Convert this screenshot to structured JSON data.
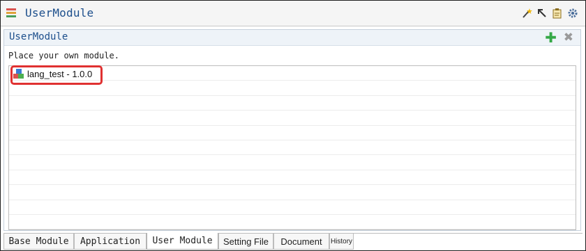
{
  "window": {
    "title": "UserModule",
    "toolbar_icons": [
      "magic-wand-icon",
      "arrow-up-left-icon",
      "clipboard-icon",
      "gear-icon"
    ]
  },
  "panel": {
    "title": "UserModule",
    "add_icon": "plus-icon",
    "close_icon": "close-icon",
    "hint": "Place your own module."
  },
  "modules": [
    {
      "name": "lang_test - 1.0.0",
      "icon": "module-blocks-icon"
    }
  ],
  "highlight_color": "#e03131",
  "tabs": [
    {
      "label": "Base Module",
      "active": false
    },
    {
      "label": "Application",
      "active": false
    },
    {
      "label": "User Module",
      "active": true
    },
    {
      "label": "Setting File",
      "active": false
    },
    {
      "label": "Document",
      "active": false
    },
    {
      "label": "History",
      "active": false
    }
  ]
}
